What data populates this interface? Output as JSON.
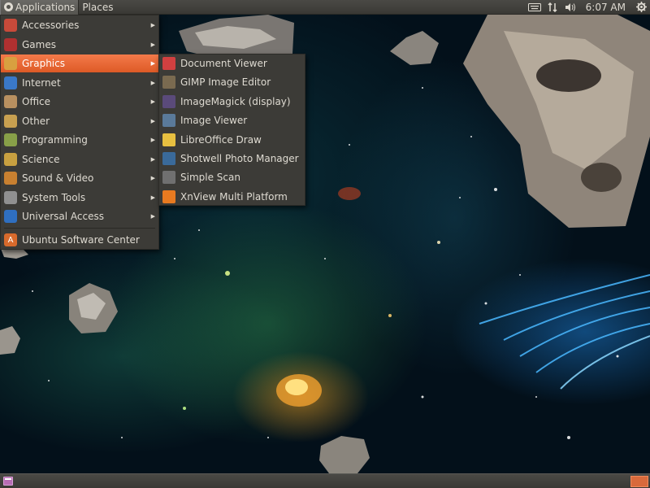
{
  "top_panel": {
    "applications_label": "Applications",
    "places_label": "Places",
    "clock": "6:07 AM"
  },
  "applications_menu": {
    "items": [
      {
        "label": "Accessories",
        "icon": "accessories-icon",
        "color": "#c84a3a"
      },
      {
        "label": "Games",
        "icon": "games-icon",
        "color": "#b03030"
      },
      {
        "label": "Graphics",
        "icon": "graphics-icon",
        "color": "#d8a040"
      },
      {
        "label": "Internet",
        "icon": "internet-icon",
        "color": "#3a78c8"
      },
      {
        "label": "Office",
        "icon": "office-icon",
        "color": "#b89060"
      },
      {
        "label": "Other",
        "icon": "other-icon",
        "color": "#c8a050"
      },
      {
        "label": "Programming",
        "icon": "programming-icon",
        "color": "#88a048"
      },
      {
        "label": "Science",
        "icon": "science-icon",
        "color": "#c8a040"
      },
      {
        "label": "Sound & Video",
        "icon": "sound-video-icon",
        "color": "#c88030"
      },
      {
        "label": "System Tools",
        "icon": "system-tools-icon",
        "color": "#909090"
      },
      {
        "label": "Universal Access",
        "icon": "universal-access-icon",
        "color": "#2f6fc0"
      }
    ],
    "highlighted": "Graphics",
    "software_center_label": "Ubuntu Software Center",
    "software_center_color": "#d86a2c"
  },
  "graphics_submenu": {
    "items": [
      {
        "label": "Document Viewer",
        "icon": "document-viewer-icon",
        "color": "#d04040"
      },
      {
        "label": "GIMP Image Editor",
        "icon": "gimp-icon",
        "color": "#7a6a50"
      },
      {
        "label": "ImageMagick (display)",
        "icon": "imagemagick-icon",
        "color": "#5a4a7a"
      },
      {
        "label": "Image Viewer",
        "icon": "image-viewer-icon",
        "color": "#5a7a9a"
      },
      {
        "label": "LibreOffice Draw",
        "icon": "libreoffice-draw-icon",
        "color": "#e8c040"
      },
      {
        "label": "Shotwell Photo Manager",
        "icon": "shotwell-icon",
        "color": "#3a6a9a"
      },
      {
        "label": "Simple Scan",
        "icon": "simple-scan-icon",
        "color": "#707070"
      },
      {
        "label": "XnView Multi Platform",
        "icon": "xnview-icon",
        "color": "#e87a20"
      }
    ]
  },
  "colors": {
    "panel": "#3c3b37",
    "menu_highlight": "#e8612c",
    "text": "#dfdbd2"
  }
}
